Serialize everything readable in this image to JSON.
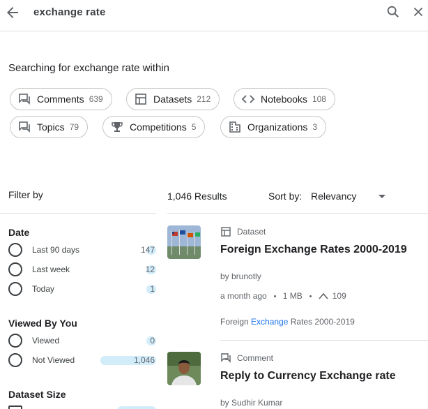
{
  "search": {
    "query": "exchange rate"
  },
  "within_text": "Searching for exchange rate within",
  "chips": [
    {
      "label": "Comments",
      "count": "639",
      "icon": "comment-icon"
    },
    {
      "label": "Datasets",
      "count": "212",
      "icon": "table-icon"
    },
    {
      "label": "Notebooks",
      "count": "108",
      "icon": "code-icon"
    },
    {
      "label": "Topics",
      "count": "79",
      "icon": "forum-icon"
    },
    {
      "label": "Competitions",
      "count": "5",
      "icon": "trophy-icon"
    },
    {
      "label": "Organizations",
      "count": "3",
      "icon": "building-icon"
    }
  ],
  "filter": {
    "title": "Filter by",
    "date": {
      "heading": "Date",
      "options": [
        {
          "label": "Last 90 days",
          "count": "147",
          "fraction": 0.14
        },
        {
          "label": "Last week",
          "count": "12",
          "fraction": 0.011
        },
        {
          "label": "Today",
          "count": "1",
          "fraction": 0.001
        }
      ]
    },
    "viewed": {
      "heading": "Viewed By You",
      "options": [
        {
          "label": "Viewed",
          "count": "0",
          "fraction": 0
        },
        {
          "label": "Not Viewed",
          "count": "1,046",
          "fraction": 1.0
        }
      ]
    },
    "dataset_size": {
      "heading": "Dataset Size"
    }
  },
  "results_header": {
    "count": "1,046 Results",
    "sort_label": "Sort by:",
    "sort_value": "Relevancy"
  },
  "results": [
    {
      "type": "Dataset",
      "title": "Foreign Exchange Rates 2000-2019",
      "by": "by brunotly",
      "age": "a month ago",
      "size": "1 MB",
      "votes": "109",
      "snippet_pre": "Foreign ",
      "snippet_hl": "Exchange",
      "snippet_post": " Rates 2000-2019"
    },
    {
      "type": "Comment",
      "title": "Reply to Currency Exchange rate",
      "by": "by Sudhir Kumar"
    }
  ],
  "colors": {
    "highlight": "#1a73e8",
    "bar": "#d2ecfa",
    "text": "#202124",
    "muted": "#5f6368"
  }
}
